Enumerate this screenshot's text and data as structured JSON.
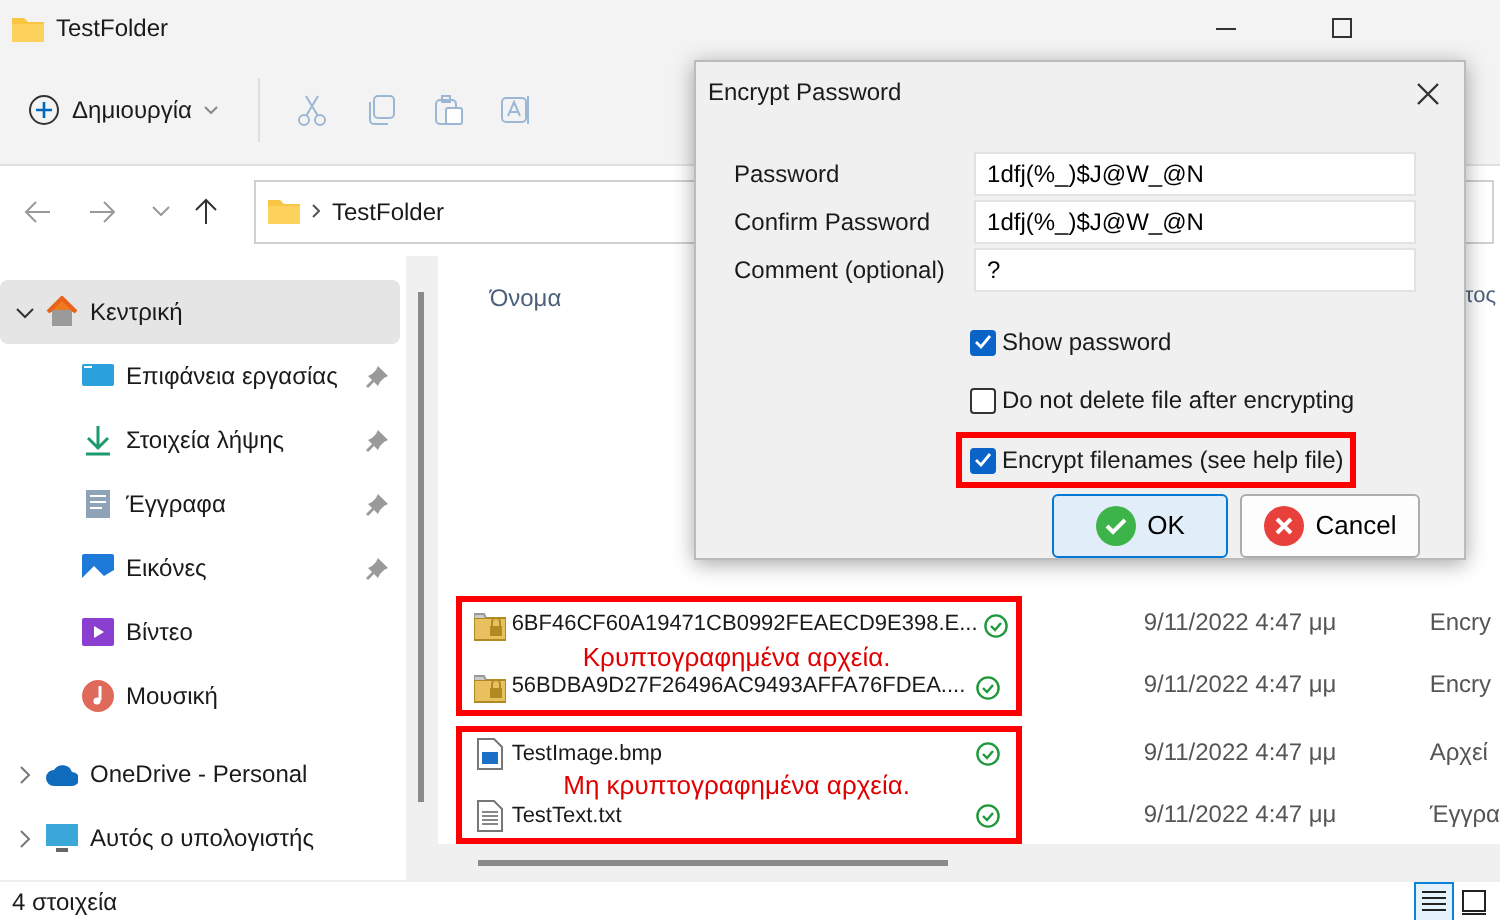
{
  "window": {
    "title": "TestFolder"
  },
  "toolbar": {
    "new_button": "Δημιουργία"
  },
  "address_bar": {
    "path": "TestFolder"
  },
  "sidebar": {
    "items": [
      {
        "label": "Κεντρική",
        "kind": "home",
        "selected": true,
        "expandable": true,
        "pinned": false
      },
      {
        "label": "Επιφάνεια εργασίας",
        "kind": "desktop",
        "selected": false,
        "expandable": false,
        "pinned": true
      },
      {
        "label": "Στοιχεία λήψης",
        "kind": "download",
        "selected": false,
        "expandable": false,
        "pinned": true
      },
      {
        "label": "Έγγραφα",
        "kind": "documents",
        "selected": false,
        "expandable": false,
        "pinned": true
      },
      {
        "label": "Εικόνες",
        "kind": "pictures",
        "selected": false,
        "expandable": false,
        "pinned": true
      },
      {
        "label": "Βίντεο",
        "kind": "videos",
        "selected": false,
        "expandable": false,
        "pinned": false
      },
      {
        "label": "Μουσική",
        "kind": "music",
        "selected": false,
        "expandable": false,
        "pinned": false
      },
      {
        "label": "OneDrive - Personal",
        "kind": "cloud",
        "selected": false,
        "expandable": true,
        "pinned": false
      },
      {
        "label": "Αυτός ο υπολογιστής",
        "kind": "computer",
        "selected": false,
        "expandable": true,
        "pinned": false
      }
    ]
  },
  "columns": [
    "Όνομα",
    "τος"
  ],
  "file_groups": [
    {
      "annotation": "Κρυπτογραφημένα αρχεία.",
      "rows": [
        {
          "name": "6BF46CF60A19471CB0992FEAECD9E398.E...",
          "kind": "locked-folder",
          "date": "9/11/2022 4:47 μμ",
          "type": "Encry"
        },
        {
          "name": "56BDBA9D27F26496AC9493AFFA76FDEA....",
          "kind": "locked-folder",
          "date": "9/11/2022 4:47 μμ",
          "type": "Encry"
        }
      ]
    },
    {
      "annotation": "Μη κρυπτογραφημένα αρχεία.",
      "rows": [
        {
          "name": "TestImage.bmp",
          "kind": "image",
          "date": "9/11/2022 4:47 μμ",
          "type": "Αρχεί"
        },
        {
          "name": "TestText.txt",
          "kind": "text",
          "date": "9/11/2022 4:47 μμ",
          "type": "Έγγρα"
        }
      ]
    }
  ],
  "status_bar": {
    "count": "4 στοιχεία",
    "views": [
      {
        "kind": "details",
        "selected": true
      },
      {
        "kind": "tiles",
        "selected": false
      }
    ]
  },
  "dialog": {
    "title": "Encrypt Password",
    "fields": [
      {
        "label": "Password",
        "value": "1dfj(%_)$J@W_@N"
      },
      {
        "label": "Confirm Password",
        "value": "1dfj(%_)$J@W_@N"
      },
      {
        "label": "Comment (optional)",
        "value": "?"
      }
    ],
    "checkboxes": [
      {
        "label": "Show password",
        "checked": true,
        "highlighted": false
      },
      {
        "label": "Do not delete file after encrypting",
        "checked": false,
        "highlighted": false
      },
      {
        "label": "Encrypt filenames (see help file)",
        "checked": true,
        "highlighted": true
      }
    ],
    "buttons": [
      {
        "label": "OK",
        "kind": "ok",
        "default": true
      },
      {
        "label": "Cancel",
        "kind": "cancel",
        "default": false
      }
    ]
  }
}
